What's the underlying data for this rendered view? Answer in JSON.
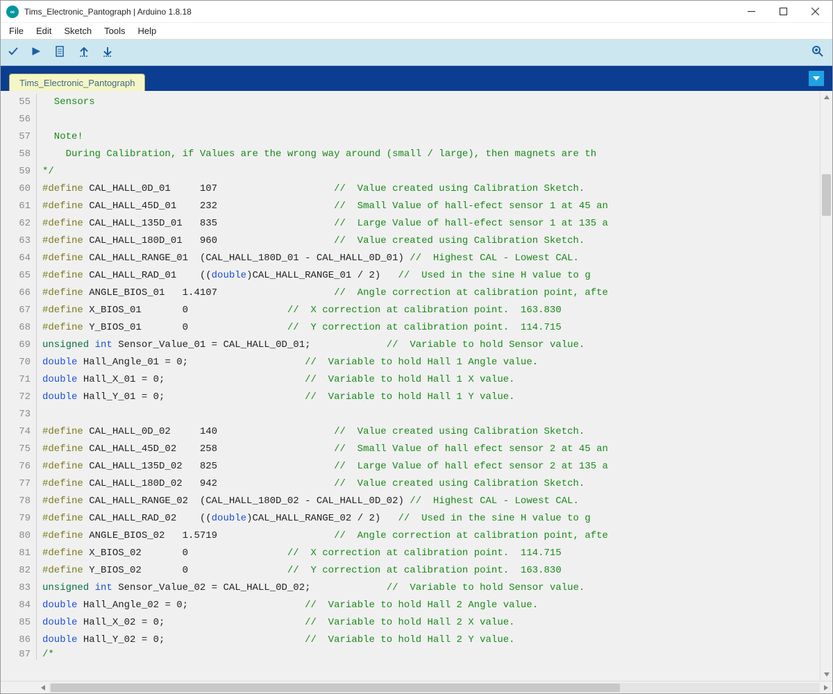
{
  "titlebar": {
    "title": "Tims_Electronic_Pantograph | Arduino 1.8.18"
  },
  "menu": {
    "file": "File",
    "edit": "Edit",
    "sketch": "Sketch",
    "tools": "Tools",
    "help": "Help"
  },
  "tab": {
    "name": "Tims_Electronic_Pantograph"
  },
  "lines": [
    {
      "n": 55,
      "segs": [
        {
          "c": "k-green",
          "t": "  Sensors"
        }
      ]
    },
    {
      "n": 56,
      "segs": []
    },
    {
      "n": 57,
      "segs": [
        {
          "c": "k-green",
          "t": "  Note!"
        }
      ]
    },
    {
      "n": 58,
      "segs": [
        {
          "c": "k-green",
          "t": "    During Calibration, if Values are the wrong way around (small / large), then magnets are th"
        }
      ]
    },
    {
      "n": 59,
      "segs": [
        {
          "c": "k-green",
          "t": "*/"
        }
      ]
    },
    {
      "n": 60,
      "segs": [
        {
          "c": "k-olive",
          "t": "#define"
        },
        {
          "t": " CAL_HALL_0D_01     107                    "
        },
        {
          "c": "k-green",
          "t": "//  Value created using Calibration Sketch."
        }
      ]
    },
    {
      "n": 61,
      "segs": [
        {
          "c": "k-olive",
          "t": "#define"
        },
        {
          "t": " CAL_HALL_45D_01    232                    "
        },
        {
          "c": "k-green",
          "t": "//  Small Value of hall-efect sensor 1 at 45 an"
        }
      ]
    },
    {
      "n": 62,
      "segs": [
        {
          "c": "k-olive",
          "t": "#define"
        },
        {
          "t": " CAL_HALL_135D_01   835                    "
        },
        {
          "c": "k-green",
          "t": "//  Large Value of hall-efect sensor 1 at 135 a"
        }
      ]
    },
    {
      "n": 63,
      "segs": [
        {
          "c": "k-olive",
          "t": "#define"
        },
        {
          "t": " CAL_HALL_180D_01   960                    "
        },
        {
          "c": "k-green",
          "t": "//  Value created using Calibration Sketch."
        }
      ]
    },
    {
      "n": 64,
      "segs": [
        {
          "c": "k-olive",
          "t": "#define"
        },
        {
          "t": " CAL_HALL_RANGE_01  (CAL_HALL_180D_01 - CAL_HALL_0D_01) "
        },
        {
          "c": "k-green",
          "t": "//  Highest CAL - Lowest CAL."
        }
      ]
    },
    {
      "n": 65,
      "segs": [
        {
          "c": "k-olive",
          "t": "#define"
        },
        {
          "t": " CAL_HALL_RAD_01    (("
        },
        {
          "c": "k-blue",
          "t": "double"
        },
        {
          "t": ")CAL_HALL_RANGE_01 / 2)   "
        },
        {
          "c": "k-green",
          "t": "//  Used in the sine H value to g"
        }
      ]
    },
    {
      "n": 66,
      "segs": [
        {
          "c": "k-olive",
          "t": "#define"
        },
        {
          "t": " ANGLE_BIOS_01   1.4107                    "
        },
        {
          "c": "k-green",
          "t": "//  Angle correction at calibration point, afte"
        }
      ]
    },
    {
      "n": 67,
      "segs": [
        {
          "c": "k-olive",
          "t": "#define"
        },
        {
          "t": " X_BIOS_01       0                 "
        },
        {
          "c": "k-green",
          "t": "//  X correction at calibration point.  163.830"
        }
      ]
    },
    {
      "n": 68,
      "segs": [
        {
          "c": "k-olive",
          "t": "#define"
        },
        {
          "t": " Y_BIOS_01       0                 "
        },
        {
          "c": "k-green",
          "t": "//  Y correction at calibration point.  114.715"
        }
      ]
    },
    {
      "n": 69,
      "segs": [
        {
          "c": "k-dgreen",
          "t": "unsigned"
        },
        {
          "t": " "
        },
        {
          "c": "k-blue",
          "t": "int"
        },
        {
          "t": " Sensor_Value_01 = CAL_HALL_0D_01;             "
        },
        {
          "c": "k-green",
          "t": "//  Variable to hold Sensor value."
        }
      ]
    },
    {
      "n": 70,
      "segs": [
        {
          "c": "k-blue",
          "t": "double"
        },
        {
          "t": " Hall_Angle_01 = 0;                    "
        },
        {
          "c": "k-green",
          "t": "//  Variable to hold Hall 1 Angle value."
        }
      ]
    },
    {
      "n": 71,
      "segs": [
        {
          "c": "k-blue",
          "t": "double"
        },
        {
          "t": " Hall_X_01 = 0;                        "
        },
        {
          "c": "k-green",
          "t": "//  Variable to hold Hall 1 X value."
        }
      ]
    },
    {
      "n": 72,
      "segs": [
        {
          "c": "k-blue",
          "t": "double"
        },
        {
          "t": " Hall_Y_01 = 0;                        "
        },
        {
          "c": "k-green",
          "t": "//  Variable to hold Hall 1 Y value."
        }
      ]
    },
    {
      "n": 73,
      "segs": []
    },
    {
      "n": 74,
      "segs": [
        {
          "c": "k-olive",
          "t": "#define"
        },
        {
          "t": " CAL_HALL_0D_02     140                    "
        },
        {
          "c": "k-green",
          "t": "//  Value created using Calibration Sketch."
        }
      ]
    },
    {
      "n": 75,
      "segs": [
        {
          "c": "k-olive",
          "t": "#define"
        },
        {
          "t": " CAL_HALL_45D_02    258                    "
        },
        {
          "c": "k-green",
          "t": "//  Small Value of hall efect sensor 2 at 45 an"
        }
      ]
    },
    {
      "n": 76,
      "segs": [
        {
          "c": "k-olive",
          "t": "#define"
        },
        {
          "t": " CAL_HALL_135D_02   825                    "
        },
        {
          "c": "k-green",
          "t": "//  Large Value of hall efect sensor 2 at 135 a"
        }
      ]
    },
    {
      "n": 77,
      "segs": [
        {
          "c": "k-olive",
          "t": "#define"
        },
        {
          "t": " CAL_HALL_180D_02   942                    "
        },
        {
          "c": "k-green",
          "t": "//  Value created using Calibration Sketch."
        }
      ]
    },
    {
      "n": 78,
      "segs": [
        {
          "c": "k-olive",
          "t": "#define"
        },
        {
          "t": " CAL_HALL_RANGE_02  (CAL_HALL_180D_02 - CAL_HALL_0D_02) "
        },
        {
          "c": "k-green",
          "t": "//  Highest CAL - Lowest CAL."
        }
      ]
    },
    {
      "n": 79,
      "segs": [
        {
          "c": "k-olive",
          "t": "#define"
        },
        {
          "t": " CAL_HALL_RAD_02    (("
        },
        {
          "c": "k-blue",
          "t": "double"
        },
        {
          "t": ")CAL_HALL_RANGE_02 / 2)   "
        },
        {
          "c": "k-green",
          "t": "//  Used in the sine H value to g"
        }
      ]
    },
    {
      "n": 80,
      "segs": [
        {
          "c": "k-olive",
          "t": "#define"
        },
        {
          "t": " ANGLE_BIOS_02   1.5719                    "
        },
        {
          "c": "k-green",
          "t": "//  Angle correction at calibration point, afte"
        }
      ]
    },
    {
      "n": 81,
      "segs": [
        {
          "c": "k-olive",
          "t": "#define"
        },
        {
          "t": " X_BIOS_02       0                 "
        },
        {
          "c": "k-green",
          "t": "//  X correction at calibration point.  114.715"
        }
      ]
    },
    {
      "n": 82,
      "segs": [
        {
          "c": "k-olive",
          "t": "#define"
        },
        {
          "t": " Y_BIOS_02       0                 "
        },
        {
          "c": "k-green",
          "t": "//  Y correction at calibration point.  163.830"
        }
      ]
    },
    {
      "n": 83,
      "segs": [
        {
          "c": "k-dgreen",
          "t": "unsigned"
        },
        {
          "t": " "
        },
        {
          "c": "k-blue",
          "t": "int"
        },
        {
          "t": " Sensor_Value_02 = CAL_HALL_0D_02;             "
        },
        {
          "c": "k-green",
          "t": "//  Variable to hold Sensor value."
        }
      ]
    },
    {
      "n": 84,
      "segs": [
        {
          "c": "k-blue",
          "t": "double"
        },
        {
          "t": " Hall_Angle_02 = 0;                    "
        },
        {
          "c": "k-green",
          "t": "//  Variable to hold Hall 2 Angle value."
        }
      ]
    },
    {
      "n": 85,
      "segs": [
        {
          "c": "k-blue",
          "t": "double"
        },
        {
          "t": " Hall_X_02 = 0;                        "
        },
        {
          "c": "k-green",
          "t": "//  Variable to hold Hall 2 X value."
        }
      ]
    },
    {
      "n": 86,
      "segs": [
        {
          "c": "k-blue",
          "t": "double"
        },
        {
          "t": " Hall_Y_02 = 0;                        "
        },
        {
          "c": "k-green",
          "t": "//  Variable to hold Hall 2 Y value."
        }
      ]
    },
    {
      "n": 87,
      "segs": [
        {
          "c": "k-green",
          "t": "/*"
        }
      ],
      "half": true
    }
  ]
}
